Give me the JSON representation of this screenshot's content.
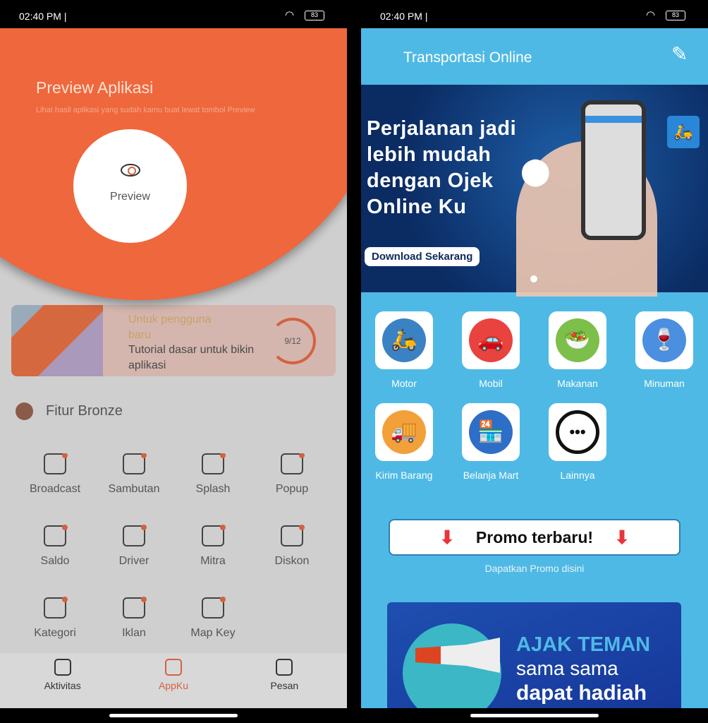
{
  "status": {
    "time": "02:40 PM |",
    "battery": "83"
  },
  "left": {
    "overlay": {
      "title": "Preview Aplikasi",
      "subtitle": "Lihat hasil aplikasi yang sudah kamu buat lewat tombol Preview",
      "button": "Preview",
      "icon": "eye-icon"
    },
    "tutorial": {
      "tag": "Untuk pengguna baru",
      "title": "Tutorial dasar untuk bikin aplikasi",
      "progress": "9/12",
      "progress_fraction": 0.75
    },
    "section": "Fitur Bronze",
    "features": [
      "Broadcast",
      "Sambutan",
      "Splash",
      "Popup",
      "Saldo",
      "Driver",
      "Mitra",
      "Diskon",
      "Kategori",
      "Iklan",
      "Map Key"
    ],
    "nav": [
      {
        "label": "Aktivitas",
        "icon": "briefcase-icon"
      },
      {
        "label": "AppKu",
        "icon": "app-add-icon",
        "active": true
      },
      {
        "label": "Pesan",
        "icon": "message-icon"
      }
    ],
    "colors": {
      "accent": "#ef673c"
    }
  },
  "right": {
    "title": "Transportasi Online",
    "banner": {
      "headline": "Perjalanan jadi lebih mudah dengan Ojek Online Ku",
      "button": "Download Sekarang"
    },
    "services": [
      {
        "label": "Motor",
        "icon": "🛵"
      },
      {
        "label": "Mobil",
        "icon": "🚗"
      },
      {
        "label": "Makanan",
        "icon": "🥗"
      },
      {
        "label": "Minuman",
        "icon": "🍷"
      },
      {
        "label": "Kirim Barang",
        "icon": "🚚"
      },
      {
        "label": "Belanja Mart",
        "icon": "🏪"
      },
      {
        "label": "Lainnya",
        "icon": "•••"
      }
    ],
    "promo": {
      "label": "Promo terbaru!",
      "subtitle": "Dapatkan Promo disini"
    },
    "banner2": {
      "line1": "AJAK TEMAN",
      "line2": "sama sama",
      "line3": "dapat hadiah"
    },
    "colors": {
      "background": "#4fb9e5",
      "banner": "#0b2b63"
    }
  }
}
